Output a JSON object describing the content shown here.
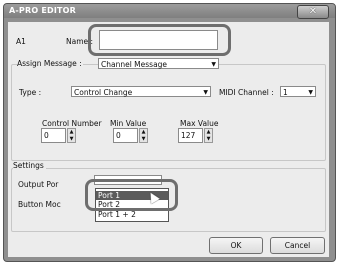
{
  "window": {
    "title": "A-PRO EDITOR",
    "close_glyph": "✕"
  },
  "name_row": {
    "slot": "A1",
    "label": "Name :",
    "value": ""
  },
  "assign": {
    "label": "Assign Message :",
    "value": "Channel Message",
    "type_label": "Type :",
    "type_value": "Control Change",
    "midi_label": "MIDI Channel :",
    "midi_value": "1",
    "control_label": "Control Number",
    "control_value": "0",
    "min_label": "Min Value",
    "min_value": "0",
    "max_label": "Max Value",
    "max_value": "127"
  },
  "settings": {
    "label": "Settings",
    "output_label": "Output Por",
    "button_label": "Button Moc",
    "output_options": [
      "Port 1",
      "Port 2",
      "Port 1 + 2"
    ]
  },
  "footer": {
    "ok_label": "OK",
    "cancel_label": "Cancel"
  },
  "icons": {
    "dropdown": "chevron-down-icon",
    "spin_up": "arrow-up-icon",
    "spin_down": "arrow-down-icon"
  }
}
